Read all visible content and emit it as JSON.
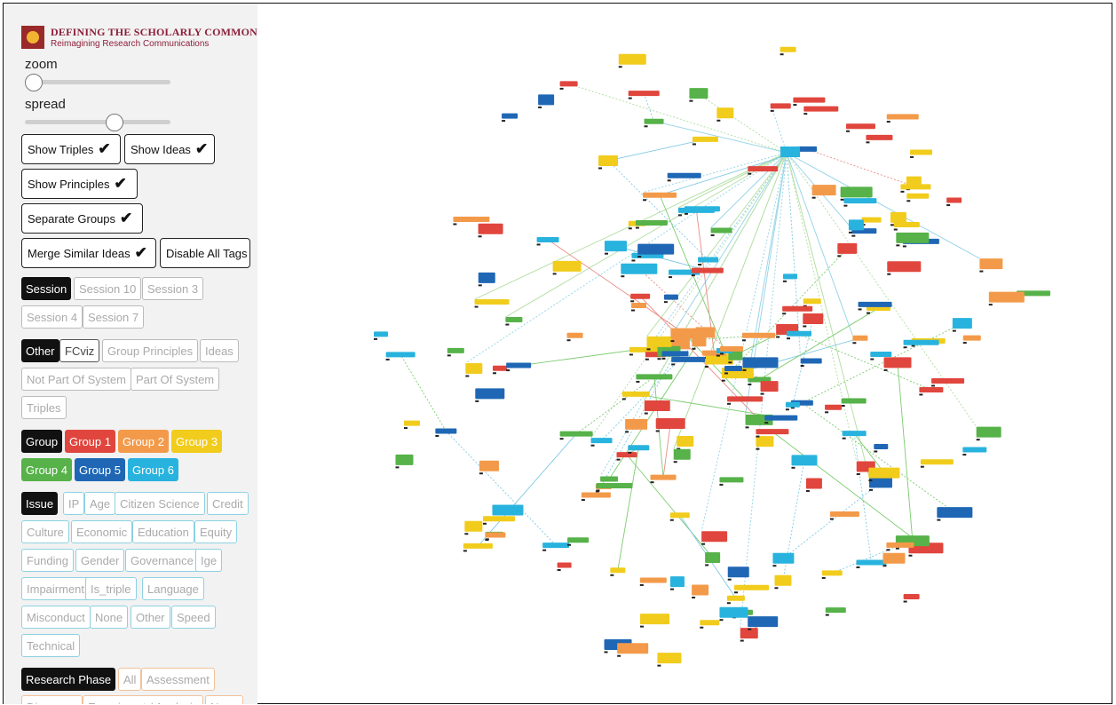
{
  "logo": {
    "title": "DEFINING THE SCHOLARLY COMMONS",
    "subtitle": "Reimagining Research Communications"
  },
  "sliders": {
    "zoom": {
      "label": "zoom",
      "value": 0.0
    },
    "spread": {
      "label": "spread",
      "value": 0.6
    }
  },
  "toggles": {
    "show_triples": {
      "label": "Show Triples",
      "check": "✔"
    },
    "show_ideas": {
      "label": "Show Ideas",
      "check": "✔"
    },
    "show_principles": {
      "label": "Show Principles",
      "check": "✔"
    },
    "separate_groups": {
      "label": "Separate Groups",
      "check": "✔"
    },
    "merge_similar": {
      "label": "Merge Similar Ideas",
      "check": "✔"
    },
    "disable_tags": {
      "label": "Disable All Tags"
    }
  },
  "filters": {
    "session": {
      "head": "Session",
      "items": [
        "Session 10",
        "Session 3",
        "Session 4",
        "Session 7"
      ]
    },
    "other": {
      "head": "Other",
      "items": [
        "FCviz",
        "Group Principles",
        "Ideas",
        "Not Part Of System",
        "Part Of System",
        "Triples"
      ]
    },
    "group": {
      "head": "Group",
      "items": [
        {
          "label": "Group 1",
          "color": "#e0463d"
        },
        {
          "label": "Group 2",
          "color": "#f39a4a"
        },
        {
          "label": "Group 3",
          "color": "#f1cc1c"
        },
        {
          "label": "Group 4",
          "color": "#56b249"
        },
        {
          "label": "Group 5",
          "color": "#1f67b5"
        },
        {
          "label": "Group 6",
          "color": "#28b3de"
        }
      ]
    },
    "issue": {
      "head": "Issue",
      "items": [
        "IP",
        "Age",
        "Citizen Science",
        "Credit",
        "Culture",
        "Economic",
        "Education",
        "Equity",
        "Funding",
        "Gender",
        "Governance",
        "Ige",
        "Impairment",
        "Is_triple",
        "Language",
        "Misconduct",
        "None",
        "Other",
        "Speed",
        "Technical"
      ]
    },
    "research_phase": {
      "head": "Research Phase",
      "items": [
        "All",
        "Assessment",
        "Discovery",
        "Experiment / Analysis",
        "None"
      ]
    }
  }
}
